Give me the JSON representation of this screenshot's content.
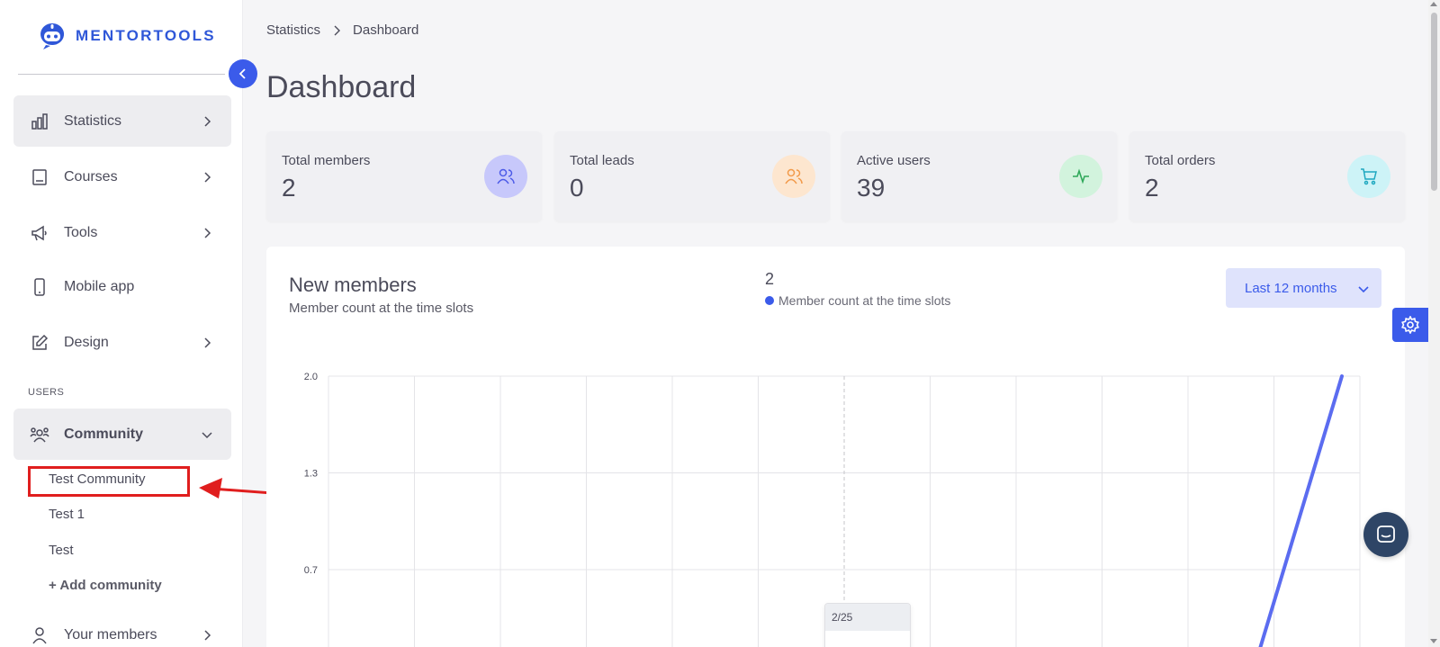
{
  "app": {
    "brand": "MENTORTOOLS",
    "brand_color": "#2f57d8",
    "accent_color": "#3b5bea"
  },
  "sidebar": {
    "items": [
      {
        "label": "Statistics",
        "icon": "bar-chart-icon",
        "active": true,
        "has_chevron": true
      },
      {
        "label": "Courses",
        "icon": "book-icon",
        "has_chevron": true
      },
      {
        "label": "Tools",
        "icon": "megaphone-icon",
        "has_chevron": true
      },
      {
        "label": "Mobile app",
        "icon": "phone-icon",
        "has_chevron": false
      },
      {
        "label": "Design",
        "icon": "pencil-icon",
        "has_chevron": true
      }
    ],
    "users_section_label": "USERS",
    "community": {
      "label": "Community",
      "icon": "community-icon",
      "expanded": true,
      "subitems": [
        "Test Community",
        "Test 1",
        "Test"
      ],
      "add_label": "+ Add community"
    },
    "your_members": {
      "label": "Your members",
      "icon": "user-icon"
    }
  },
  "breadcrumb": [
    "Statistics",
    "Dashboard"
  ],
  "page_title": "Dashboard",
  "stats": [
    {
      "title": "Total members",
      "value": "2",
      "icon": "users-icon",
      "color": "#c7c8fb"
    },
    {
      "title": "Total leads",
      "value": "0",
      "icon": "users-icon",
      "color": "#fde6cf"
    },
    {
      "title": "Active users",
      "value": "39",
      "icon": "activity-icon",
      "color": "#d2f3dd"
    },
    {
      "title": "Total orders",
      "value": "2",
      "icon": "cart-icon",
      "color": "#cdf3f7"
    }
  ],
  "chart": {
    "title": "New members",
    "subtitle": "Member count at the time slots",
    "legend_total": "2",
    "legend_label": "Member count at the time slots",
    "range_select": "Last 12 months",
    "tooltip_label": "2/25"
  },
  "chart_data": {
    "type": "line",
    "title": "New members",
    "subtitle": "Member count at the time slots",
    "ylim": [
      0,
      2.0
    ],
    "y_ticks": [
      "2.0",
      "1.3",
      "0.7"
    ],
    "x_slots": 12,
    "series": [
      {
        "name": "Member count at the time slots",
        "color": "#5b6cf0",
        "values": [
          0,
          0,
          0,
          0,
          0,
          0,
          0,
          0,
          0,
          0,
          0,
          0,
          2
        ]
      }
    ],
    "grid": true,
    "legend_position": "top-center"
  }
}
